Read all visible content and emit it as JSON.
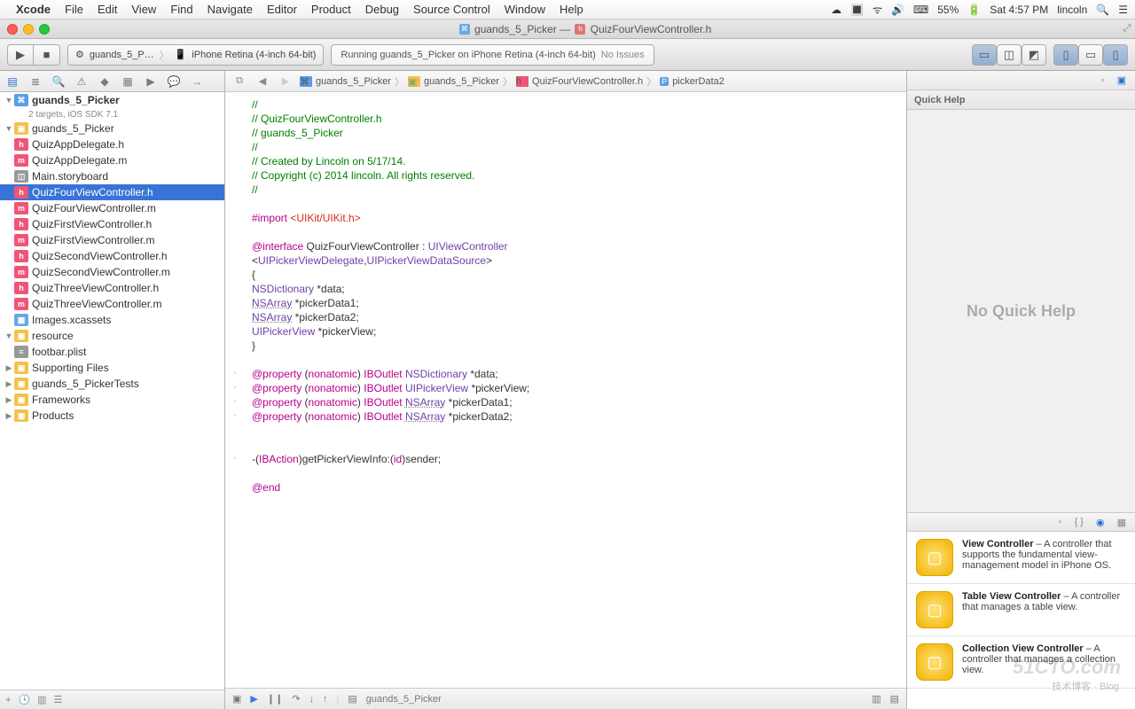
{
  "menubar": {
    "app": "Xcode",
    "items": [
      "File",
      "Edit",
      "View",
      "Find",
      "Navigate",
      "Editor",
      "Product",
      "Debug",
      "Source Control",
      "Window",
      "Help"
    ],
    "battery": "55%",
    "clock": "Sat 4:57 PM",
    "user": "lincoln"
  },
  "window": {
    "title_left": "guands_5_Picker",
    "title_sep": " — ",
    "title_right": "QuizFourViewController.h"
  },
  "toolbar": {
    "scheme_target": "guands_5_P…",
    "scheme_dest": "iPhone Retina (4-inch 64-bit)",
    "activity": "Running guands_5_Picker on iPhone Retina (4-inch 64-bit)",
    "issues": "No Issues"
  },
  "navigator": {
    "project": "guands_5_Picker",
    "project_sub": "2 targets, iOS SDK 7.1",
    "tree": [
      {
        "lvl": 1,
        "open": true,
        "icon": "fold",
        "label": "guands_5_Picker"
      },
      {
        "lvl": 2,
        "icon": "h",
        "label": "QuizAppDelegate.h"
      },
      {
        "lvl": 2,
        "icon": "m",
        "label": "QuizAppDelegate.m"
      },
      {
        "lvl": 2,
        "icon": "sb",
        "label": "Main.storyboard"
      },
      {
        "lvl": 2,
        "icon": "h",
        "label": "QuizFourViewController.h",
        "selected": true
      },
      {
        "lvl": 2,
        "icon": "m",
        "label": "QuizFourViewController.m"
      },
      {
        "lvl": 2,
        "icon": "h",
        "label": "QuizFirstViewController.h"
      },
      {
        "lvl": 2,
        "icon": "m",
        "label": "QuizFirstViewController.m"
      },
      {
        "lvl": 2,
        "icon": "h",
        "label": "QuizSecondViewController.h"
      },
      {
        "lvl": 2,
        "icon": "m",
        "label": "QuizSecondViewController.m"
      },
      {
        "lvl": 2,
        "icon": "h",
        "label": "QuizThreeViewController.h"
      },
      {
        "lvl": 2,
        "icon": "m",
        "label": "QuizThreeViewController.m"
      },
      {
        "lvl": 2,
        "icon": "xc",
        "label": "Images.xcassets"
      },
      {
        "lvl": 2,
        "open": true,
        "icon": "fold",
        "label": "resource"
      },
      {
        "lvl": 3,
        "icon": "pl",
        "label": "footbar.plist"
      },
      {
        "lvl": 2,
        "icon": "fold",
        "label": "Supporting Files",
        "closed": true
      },
      {
        "lvl": 1,
        "icon": "fold",
        "label": "guands_5_PickerTests",
        "closed": true
      },
      {
        "lvl": 1,
        "icon": "fold",
        "label": "Frameworks",
        "closed": true
      },
      {
        "lvl": 1,
        "icon": "fold",
        "label": "Products",
        "closed": true
      }
    ]
  },
  "jumpbar": {
    "crumbs": [
      "guands_5_Picker",
      "guands_5_Picker",
      "QuizFourViewController.h",
      "pickerData2"
    ]
  },
  "code": {
    "lines": [
      {
        "t": "//",
        "cls": "c-comment"
      },
      {
        "t": "//  QuizFourViewController.h",
        "cls": "c-comment"
      },
      {
        "t": "//  guands_5_Picker",
        "cls": "c-comment"
      },
      {
        "t": "//",
        "cls": "c-comment"
      },
      {
        "t": "//  Created by Lincoln on 5/17/14.",
        "cls": "c-comment"
      },
      {
        "t": "//  Copyright (c) 2014 lincoln. All rights reserved.",
        "cls": "c-comment"
      },
      {
        "t": "//",
        "cls": "c-comment"
      },
      {
        "t": ""
      },
      {
        "html": "<span class='c-keyword'>#import</span> <span class='c-string'>&lt;UIKit/UIKit.h&gt;</span>"
      },
      {
        "t": ""
      },
      {
        "html": "<span class='c-keyword'>@interface</span> QuizFourViewController : <span class='c-type'>UIViewController</span>"
      },
      {
        "html": "&lt;<span class='c-type'>UIPickerViewDelegate</span>,<span class='c-type'>UIPickerViewDataSource</span>&gt;"
      },
      {
        "t": "{"
      },
      {
        "html": "    <span class='c-type'>NSDictionary</span> *data;"
      },
      {
        "html": "    <span class='c-type c-uline'>NSArray</span> *pickerData1;"
      },
      {
        "html": "    <span class='c-type c-uline'>NSArray</span> *pickerData2;"
      },
      {
        "html": "    <span class='c-type'>UIPickerView</span> *pickerView;"
      },
      {
        "t": "}"
      },
      {
        "t": ""
      },
      {
        "html": "<span class='c-keyword'>@property</span> (<span class='c-keyword'>nonatomic</span>) <span class='c-keyword'>IBOutlet</span> <span class='c-type'>NSDictionary</span> *data;",
        "g": "◦"
      },
      {
        "html": "<span class='c-keyword'>@property</span> (<span class='c-keyword'>nonatomic</span>) <span class='c-keyword'>IBOutlet</span> <span class='c-type'>UIPickerView</span> *pickerView;",
        "g": "◦"
      },
      {
        "html": "<span class='c-keyword'>@property</span> (<span class='c-keyword'>nonatomic</span>) <span class='c-keyword'>IBOutlet</span> <span class='c-type c-uline'>NSArray</span> *pickerData1;",
        "g": "◦"
      },
      {
        "html": "<span class='c-keyword'>@property</span> (<span class='c-keyword'>nonatomic</span>) <span class='c-keyword'>IBOutlet</span> <span class='c-type c-uline'>NSArray</span> *pickerData2;",
        "g": "◦"
      },
      {
        "t": ""
      },
      {
        "t": ""
      },
      {
        "html": "-(<span class='c-keyword'>IBAction</span>)getPickerViewInfo:(<span class='c-keyword'>id</span>)sender;",
        "g": "◦"
      },
      {
        "t": ""
      },
      {
        "html": "<span class='c-keyword'>@end</span>"
      }
    ]
  },
  "debugbar": {
    "scheme": "guands_5_Picker"
  },
  "utilities": {
    "title": "Quick Help",
    "empty": "No Quick Help",
    "library": [
      {
        "title": "View Controller",
        "desc": " – A controller that supports the fundamental view-management model in iPhone OS."
      },
      {
        "title": "Table View Controller",
        "desc": " – A controller that manages a table view."
      },
      {
        "title": "Collection View Controller",
        "desc": " – A controller that manages a collection view."
      }
    ]
  },
  "watermark": "51CTO.com",
  "watermark2": "技术博客 · Blog"
}
